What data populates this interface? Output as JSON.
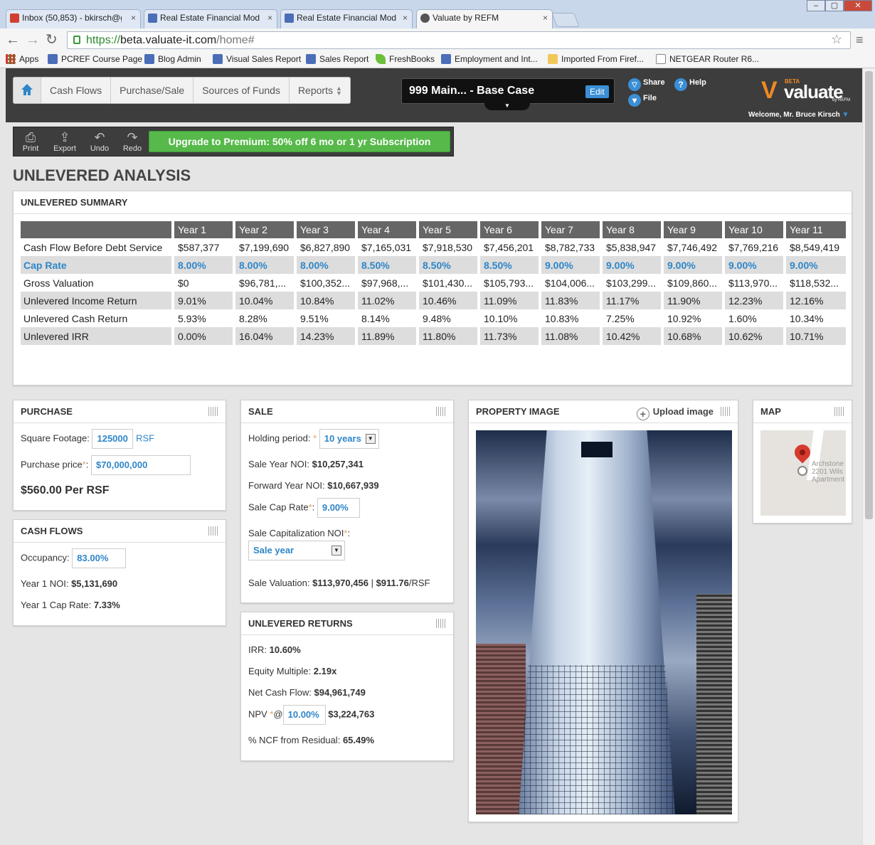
{
  "browser": {
    "tabs": [
      {
        "title": "Inbox (50,853) - bkirsch@g",
        "icon_color": "#d23f31"
      },
      {
        "title": "Real Estate Financial Mode",
        "icon_color": "#4c6eb8"
      },
      {
        "title": "Real Estate Financial Mode",
        "icon_color": "#4c6eb8"
      },
      {
        "title": "Valuate by REFM",
        "icon_color": "#555555"
      }
    ],
    "close_glyph": "×",
    "url_scheme": "https://",
    "url_host": "beta.valuate-it.com",
    "url_path": "/home#",
    "window_controls": [
      "‒",
      "▢",
      "✕"
    ],
    "bookmarks": [
      {
        "label": "Apps",
        "icon": "apps-icon"
      },
      {
        "label": "PCREF Course Page",
        "icon": "site-icon"
      },
      {
        "label": "Blog Admin",
        "icon": "site-icon"
      },
      {
        "label": "Visual Sales Report",
        "icon": "site-icon"
      },
      {
        "label": "Sales Report",
        "icon": "site-icon"
      },
      {
        "label": "FreshBooks",
        "icon": "leaf-icon"
      },
      {
        "label": "Employment and Int...",
        "icon": "site-icon"
      },
      {
        "label": "Imported From Firef...",
        "icon": "folder-icon"
      },
      {
        "label": "NETGEAR Router R6...",
        "icon": "doc-icon"
      }
    ]
  },
  "app": {
    "nav": [
      "Cash Flows",
      "Purchase/Sale",
      "Sources of Funds",
      "Reports"
    ],
    "scenario": "999 Main... - Base Case",
    "edit_label": "Edit",
    "share_label": "Share",
    "help_label": "Help",
    "file_label": "File",
    "logo": {
      "beta": "BETA",
      "name": "valuate",
      "by": "by REFM",
      "mark": "V"
    },
    "welcome": "Welcome, Mr. Bruce Kirsch",
    "actions": [
      "Print",
      "Export",
      "Undo",
      "Redo"
    ],
    "upgrade": "Upgrade to Premium: 50% off 6 mo or 1 yr Subscription",
    "accent": "#2e86c9"
  },
  "page_title": "UNLEVERED ANALYSIS",
  "summary": {
    "title": "UNLEVERED SUMMARY",
    "years": [
      "Year 1",
      "Year 2",
      "Year 3",
      "Year 4",
      "Year 5",
      "Year 6",
      "Year 7",
      "Year 8",
      "Year 9",
      "Year 10",
      "Year 11"
    ],
    "rows": [
      {
        "label": "Cash Flow Before Debt Service",
        "values": [
          "$587,377",
          "$7,199,690",
          "$6,827,890",
          "$7,165,031",
          "$7,918,530",
          "$7,456,201",
          "$8,782,733",
          "$5,838,947",
          "$7,746,492",
          "$7,769,216",
          "$8,549,419"
        ]
      },
      {
        "label": "Cap Rate",
        "values": [
          "8.00%",
          "8.00%",
          "8.00%",
          "8.50%",
          "8.50%",
          "8.50%",
          "9.00%",
          "9.00%",
          "9.00%",
          "9.00%",
          "9.00%"
        ]
      },
      {
        "label": "Gross Valuation",
        "values": [
          "$0",
          "$96,781,...",
          "$100,352...",
          "$97,968,...",
          "$101,430...",
          "$105,793...",
          "$104,006...",
          "$103,299...",
          "$109,860...",
          "$113,970...",
          "$118,532..."
        ]
      },
      {
        "label": "Unlevered Income Return",
        "values": [
          "9.01%",
          "10.04%",
          "10.84%",
          "11.02%",
          "10.46%",
          "11.09%",
          "11.83%",
          "11.17%",
          "11.90%",
          "12.23%",
          "12.16%"
        ]
      },
      {
        "label": "Unlevered Cash Return",
        "values": [
          "5.93%",
          "8.28%",
          "9.51%",
          "8.14%",
          "9.48%",
          "10.10%",
          "10.83%",
          "7.25%",
          "10.92%",
          "1.60%",
          "10.34%"
        ]
      },
      {
        "label": "Unlevered IRR",
        "values": [
          "0.00%",
          "16.04%",
          "14.23%",
          "11.89%",
          "11.80%",
          "11.73%",
          "11.08%",
          "10.42%",
          "10.68%",
          "10.62%",
          "10.71%"
        ]
      }
    ]
  },
  "purchase": {
    "title": "PURCHASE",
    "sqft_label": "Square Footage:",
    "sqft_value": "125000",
    "sqft_unit": "RSF",
    "price_label": "Purchase price",
    "price_value": "$70,000,000",
    "per_rsf": "$560.00 Per RSF"
  },
  "cash_flows": {
    "title": "CASH FLOWS",
    "occupancy_label": "Occupancy:",
    "occupancy_value": "83.00%",
    "noi_label": "Year 1 NOI:",
    "noi_value": "$5,131,690",
    "cap_label": "Year 1 Cap Rate:",
    "cap_value": "7.33%"
  },
  "sale": {
    "title": "SALE",
    "holding_label": "Holding period:",
    "holding_value": "10 years",
    "sale_noi_label": "Sale Year NOI:",
    "sale_noi_value": "$10,257,341",
    "fwd_noi_label": "Forward Year NOI:",
    "fwd_noi_value": "$10,667,939",
    "cap_label": "Sale Cap Rate",
    "cap_value": "9.00%",
    "cap_noi_label": "Sale Capitalization NOI",
    "cap_noi_value": "Sale year",
    "valuation_label": "Sale Valuation:",
    "valuation_value": "$113,970,456",
    "valuation_sep": "|",
    "valuation_per": "$911.76",
    "valuation_unit": "/RSF"
  },
  "returns": {
    "title": "UNLEVERED RETURNS",
    "irr_label": "IRR:",
    "irr_value": "10.60%",
    "em_label": "Equity Multiple:",
    "em_value": "2.19x",
    "ncf_label": "Net Cash Flow:",
    "ncf_value": "$94,961,749",
    "npv_label": "NPV",
    "npv_at": "@",
    "npv_rate": "10.00%",
    "npv_value": "$3,224,763",
    "resid_label": "% NCF from Residual:",
    "resid_value": "65.49%"
  },
  "property_image": {
    "title": "PROPERTY IMAGE",
    "upload_label": "Upload image"
  },
  "map": {
    "title": "MAP",
    "labels": [
      "Archstone",
      "2201 Wils",
      "Apartment"
    ]
  }
}
